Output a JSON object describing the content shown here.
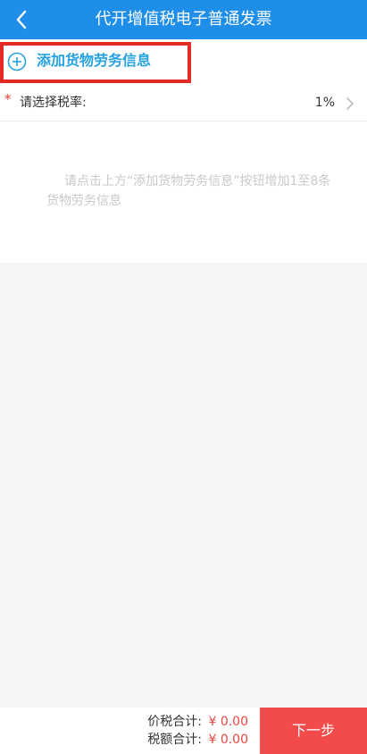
{
  "header": {
    "title": "代开增值税电子普通发票",
    "back_icon": "chevron-left-icon"
  },
  "add_goods": {
    "label": "添加货物劳务信息",
    "icon": "plus-circle-icon",
    "highlight_color": "#e32b23",
    "label_color": "#27a2e3"
  },
  "tax_rate": {
    "required_mark": "*",
    "label": "请选择税率:",
    "value": "1%",
    "icon": "chevron-right-icon"
  },
  "hint": {
    "text": "请点击上方“添加货物劳务信息”按钮增加1至8条货物劳务信息"
  },
  "footer": {
    "price_tax_total_label": "价税合计:",
    "price_tax_total_value": "¥ 0.00",
    "tax_total_label": "税额合计:",
    "tax_total_value": "¥ 0.00",
    "next_button": "下一步",
    "next_button_color": "#f24b4b"
  },
  "colors": {
    "header_bg": "#1e8ee8",
    "page_bg": "#f5f6f8"
  }
}
